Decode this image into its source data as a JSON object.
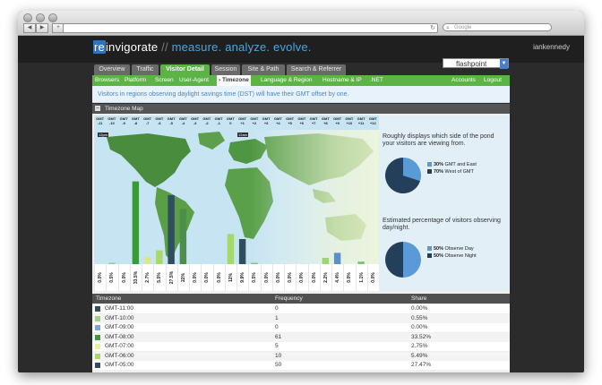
{
  "browser": {
    "search_placeholder": "Google"
  },
  "header": {
    "logo_re": "re",
    "logo_rest": "invigorate",
    "logo_slash": "//",
    "tagline": "measure. analyze. evolve.",
    "username": "iankennedy"
  },
  "tabs": [
    "Overview",
    "Traffic",
    "Visitor Detail",
    "Session",
    "Site & Path",
    "Search & Referrer"
  ],
  "profile_select": "flashpoint",
  "subnav": {
    "items": [
      "Browsers",
      "Platform",
      "Screen",
      "User-Agent",
      "› Timezone",
      "Language & Region",
      "Hostname & IP",
      ".NET"
    ],
    "right": [
      "Accounts",
      "Logout"
    ]
  },
  "notice": "Visitors in regions observing daylight savings time (DST) will have their GMT offset by one.",
  "panel": {
    "title": "Timezone Map",
    "collapse": "–"
  },
  "map": {
    "tz_labels": [
      [
        "GMT",
        "-11"
      ],
      [
        "GMT",
        "-10"
      ],
      [
        "GMT",
        "-9"
      ],
      [
        "GMT",
        "-8"
      ],
      [
        "GMT",
        "-7"
      ],
      [
        "GMT",
        "-6"
      ],
      [
        "GMT",
        "-5"
      ],
      [
        "GMT",
        "-4"
      ],
      [
        "GMT",
        "-3"
      ],
      [
        "GMT",
        "-2"
      ],
      [
        "GMT",
        "-1"
      ],
      [
        "GMT",
        "0"
      ],
      [
        "GMT",
        "+1"
      ],
      [
        "GMT",
        "+2"
      ],
      [
        "GMT",
        "+3"
      ],
      [
        "GMT",
        "+4"
      ],
      [
        "GMT",
        "+5"
      ],
      [
        "GMT",
        "+6"
      ],
      [
        "GMT",
        "+7"
      ],
      [
        "GMT",
        "+8"
      ],
      [
        "GMT",
        "+9"
      ],
      [
        "GMT",
        "+10"
      ],
      [
        "GMT",
        "+11"
      ],
      [
        "GMT",
        "+12"
      ]
    ],
    "clock_left": "12pm",
    "clock_right": "12am",
    "percentages": [
      "0.0%",
      "0.5%",
      "0.0%",
      "33.5%",
      "2.7%",
      "5.5%",
      "27.5%",
      "22%",
      "0.0%",
      "0.0%",
      "0.0%",
      "12%",
      "9.9%",
      "0.5%",
      "0.0%",
      "0.0%",
      "0.0%",
      "0.0%",
      "0.0%",
      "2.2%",
      "4.4%",
      "0.0%",
      "1.1%",
      "0.0%"
    ],
    "bar_fractions": [
      0,
      0.01,
      0,
      0.66,
      0.06,
      0.11,
      0.55,
      0.44,
      0,
      0,
      0,
      0.24,
      0.2,
      0.01,
      0,
      0,
      0,
      0,
      0,
      0.05,
      0.09,
      0,
      0.02,
      0
    ],
    "bar_colors": [
      "#2f4f5f",
      "#8fcf8f",
      "#7aa6d6",
      "#3a9a3a",
      "#d9e88a",
      "#a8d86a",
      "#2f4f5f",
      "#4b8f4b",
      "#5a8fcc",
      "#9bd27a",
      "#cfe88a",
      "#a5d86a",
      "#2f4f5f",
      "#7ac27a",
      "#5a8fcc",
      "#a5d86a",
      "#cfe88a",
      "#7ac27a",
      "#2f4f5f",
      "#9bd27a",
      "#5a8fcc",
      "#a5d86a",
      "#7ac27a",
      "#cfe88a"
    ]
  },
  "pie1": {
    "caption": "Roughly displays which side of the pond your visitors are viewing from.",
    "legend": [
      {
        "label": "GMT and East",
        "pct": "30%",
        "value": 30,
        "color": "#5a9ad6"
      },
      {
        "label": "West of GMT",
        "pct": "70%",
        "value": 70,
        "color": "#243f5a"
      }
    ]
  },
  "pie2": {
    "caption": "Estimated percentage of visitors observing day/night.",
    "legend": [
      {
        "label": "Observe Day",
        "pct": "50%",
        "value": 50,
        "color": "#5a9ad6"
      },
      {
        "label": "Observe Night",
        "pct": "50%",
        "value": 50,
        "color": "#243f5a"
      }
    ]
  },
  "table": {
    "headers": [
      "Timezone",
      "Frequency",
      "Share"
    ],
    "rows": [
      {
        "tz": "GMT-11:00",
        "freq": "0",
        "share": "0.00%",
        "color": "#2f4f5f"
      },
      {
        "tz": "GMT-10:00",
        "freq": "1",
        "share": "0.55%",
        "color": "#9fcf8f"
      },
      {
        "tz": "GMT-09:00",
        "freq": "0",
        "share": "0.00%",
        "color": "#7aa6d6"
      },
      {
        "tz": "GMT-08:00",
        "freq": "61",
        "share": "33.52%",
        "color": "#3a9a3a"
      },
      {
        "tz": "GMT-07:00",
        "freq": "5",
        "share": "2.75%",
        "color": "#e9f0a0"
      },
      {
        "tz": "GMT-06:00",
        "freq": "10",
        "share": "5.49%",
        "color": "#a8d86a"
      },
      {
        "tz": "GMT-05:00",
        "freq": "50",
        "share": "27.47%",
        "color": "#2f4f5f"
      }
    ]
  }
}
